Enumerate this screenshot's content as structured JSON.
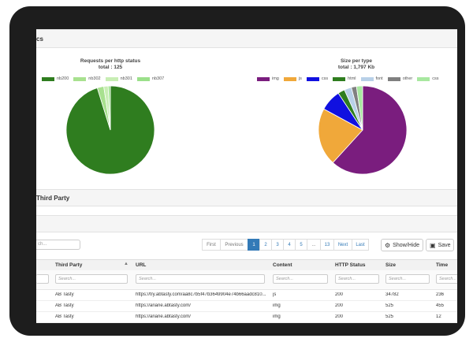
{
  "sections": {
    "stats_title": "cs",
    "third_party_title": "Third Party"
  },
  "chart_data": [
    {
      "type": "pie",
      "title": "Requests per http status",
      "subtitle": "total : 125",
      "categories": [
        "nb200",
        "nb302",
        "nb301",
        "nb307"
      ],
      "values": [
        119,
        3,
        2,
        1
      ],
      "colors": [
        "#2f7d1f",
        "#a8e18f",
        "#c8eeb4",
        "#9be08a"
      ],
      "legend": "top"
    },
    {
      "type": "pie",
      "title": "Size per type",
      "subtitle": "total : 1,797 Kb",
      "categories": [
        "img",
        "js",
        "css",
        "html",
        "font",
        "other",
        "css"
      ],
      "values": [
        1110,
        380,
        140,
        45,
        48,
        34,
        40
      ],
      "colors": [
        "#7a1d7e",
        "#f0a83a",
        "#1010e0",
        "#2f7d1f",
        "#b8d0e8",
        "#808080",
        "#a8e8a0"
      ],
      "legend": "top"
    }
  ],
  "search_placeholder": "ch...",
  "pagination": [
    "First",
    "Previous",
    "1",
    "2",
    "3",
    "4",
    "5",
    "...",
    "13",
    "Next",
    "Last"
  ],
  "buttons": {
    "show_hide": "Show/Hide",
    "save": "Save"
  },
  "table": {
    "headers": [
      "Third Party",
      "URL",
      "Content",
      "HTTP Status",
      "Size",
      "Time"
    ],
    "filter_placeholder": "Search...",
    "rows": [
      [
        "AB Tasty",
        "https://try.abtasty.com/aa8c7b5f47b3649904e74b66aadc810...",
        "js",
        "200",
        "34782",
        "236"
      ],
      [
        "AB Tasty",
        "https://ariane.abtasty.com/",
        "img",
        "200",
        "525",
        "455"
      ],
      [
        "AB Tasty",
        "https://ariane.abtasty.com/",
        "img",
        "200",
        "525",
        "12"
      ]
    ]
  }
}
